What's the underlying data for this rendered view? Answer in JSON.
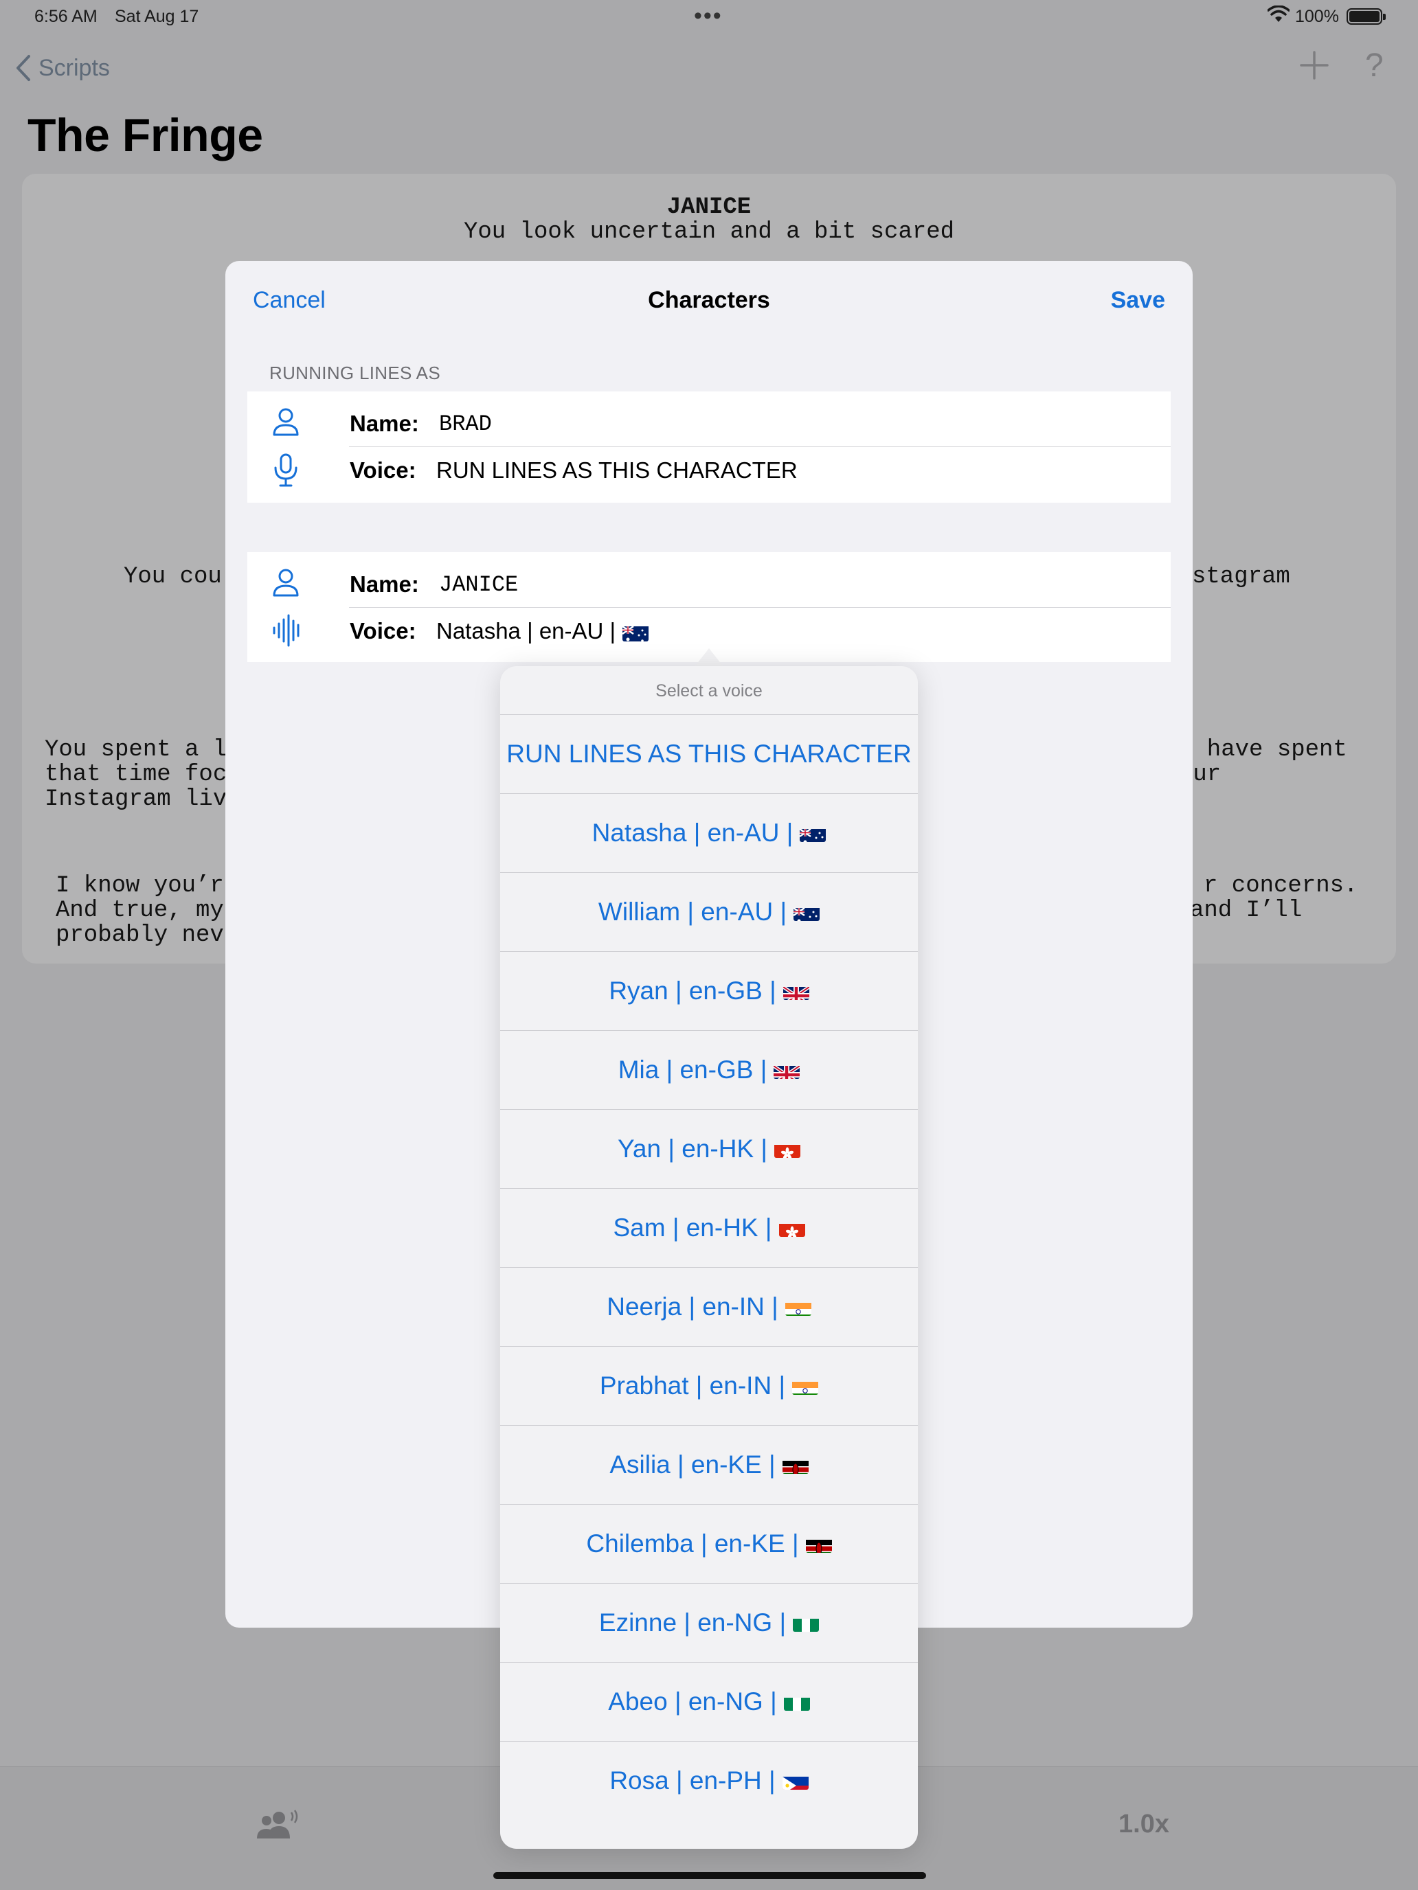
{
  "status_bar": {
    "time": "6:56 AM",
    "date": "Sat Aug 17",
    "battery": "100%"
  },
  "nav": {
    "back_label": "Scripts",
    "help_label": "?"
  },
  "page": {
    "title": "The Fringe"
  },
  "script": {
    "line1_character": "JANICE",
    "line1_text": "You look uncertain and a bit scared",
    "para2_left": "You cou",
    "para2_right": "stagram",
    "para3_left_1": "You spent a l",
    "para3_left_2": "that time foc",
    "para3_left_3": "Instagram liv",
    "para3_right_1": "d have spent",
    "para3_right_2": "our",
    "para4_left_1": "I know you’r",
    "para4_left_2": "And true, my",
    "para4_left_3": "probably nev",
    "para4_right_1": "r concerns.",
    "para4_right_2": "and I’ll"
  },
  "sheet": {
    "cancel_label": "Cancel",
    "title": "Characters",
    "save_label": "Save",
    "section_header": "RUNNING LINES AS",
    "name_label": "Name:",
    "voice_label": "Voice:",
    "characters": [
      {
        "name": "BRAD",
        "voice": "RUN LINES AS THIS CHARACTER",
        "voice_icon": "microphone-icon"
      },
      {
        "name": "JANICE",
        "voice": "Natasha | en-AU |",
        "voice_icon": "waveform-icon",
        "flag": "AU"
      }
    ]
  },
  "popover": {
    "title": "Select a voice",
    "options": [
      {
        "label": "RUN LINES AS THIS CHARACTER",
        "flag": ""
      },
      {
        "label": "Natasha | en-AU |",
        "flag": "AU"
      },
      {
        "label": "William | en-AU |",
        "flag": "AU"
      },
      {
        "label": "Ryan | en-GB |",
        "flag": "GB"
      },
      {
        "label": "Mia | en-GB |",
        "flag": "GB"
      },
      {
        "label": "Yan | en-HK |",
        "flag": "HK"
      },
      {
        "label": "Sam | en-HK |",
        "flag": "HK"
      },
      {
        "label": "Neerja | en-IN |",
        "flag": "IN"
      },
      {
        "label": "Prabhat | en-IN |",
        "flag": "IN"
      },
      {
        "label": "Asilia | en-KE |",
        "flag": "KE"
      },
      {
        "label": "Chilemba | en-KE |",
        "flag": "KE"
      },
      {
        "label": "Ezinne | en-NG |",
        "flag": "NG"
      },
      {
        "label": "Abeo | en-NG |",
        "flag": "NG"
      },
      {
        "label": "Rosa | en-PH |",
        "flag": "PH"
      }
    ]
  },
  "toolbar": {
    "speed_label": "1.0x"
  },
  "colors": {
    "accent": "#1670d8",
    "sheet_bg": "#f1f1f5",
    "dim_bg": "#a9a9ab"
  }
}
